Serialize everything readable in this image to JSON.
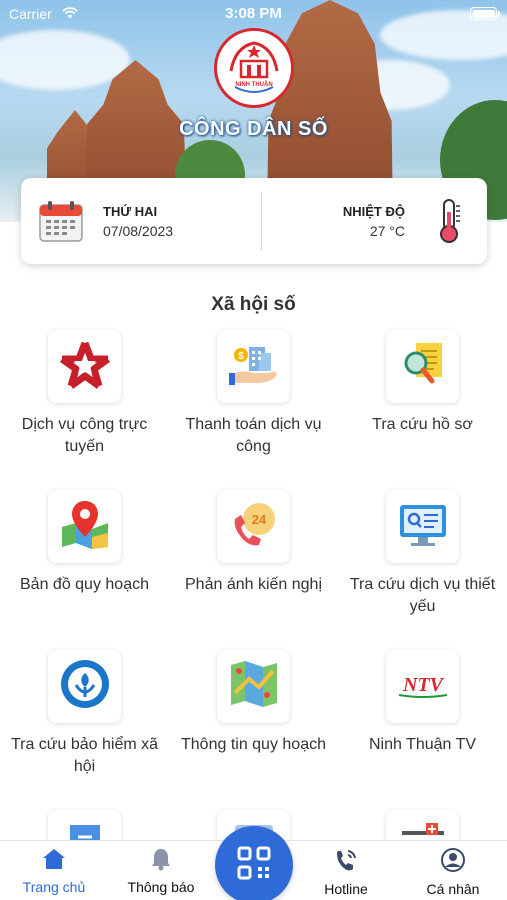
{
  "status_bar": {
    "carrier": "Carrier",
    "time": "3:08 PM"
  },
  "header": {
    "title": "CÔNG DÂN SỐ",
    "logo_text": "NINH THUẬN"
  },
  "info_card": {
    "day": "THỨ HAI",
    "date": "07/08/2023",
    "temp_label": "NHIỆT ĐỘ",
    "temp_value": "27 °C"
  },
  "section_title": "Xã hội số",
  "services": [
    {
      "label": "Dịch vụ công trực tuyến",
      "icon": "public-service-star-icon"
    },
    {
      "label": "Thanh toán dịch vụ công",
      "icon": "payment-hand-icon"
    },
    {
      "label": "Tra cứu hồ sơ",
      "icon": "document-search-icon"
    },
    {
      "label": "Bản đồ quy hoạch",
      "icon": "map-pin-icon"
    },
    {
      "label": "Phản ánh kiến nghị",
      "icon": "phone-24-icon"
    },
    {
      "label": "Tra cứu dịch vụ thiết yếu",
      "icon": "monitor-search-icon"
    },
    {
      "label": "Tra cứu bảo hiểm xã hội",
      "icon": "social-insurance-icon"
    },
    {
      "label": "Thông tin quy hoạch",
      "icon": "planning-map-icon"
    },
    {
      "label": "Ninh Thuận TV",
      "icon": "ntv-logo-icon",
      "logo_text": "NTV"
    }
  ],
  "bottom_nav": {
    "home": "Trang chủ",
    "notifications": "Thông báo",
    "hotline": "Hotline",
    "profile": "Cá nhân"
  },
  "colors": {
    "accent": "#2f6bd8",
    "logo_red": "#d8272e"
  }
}
